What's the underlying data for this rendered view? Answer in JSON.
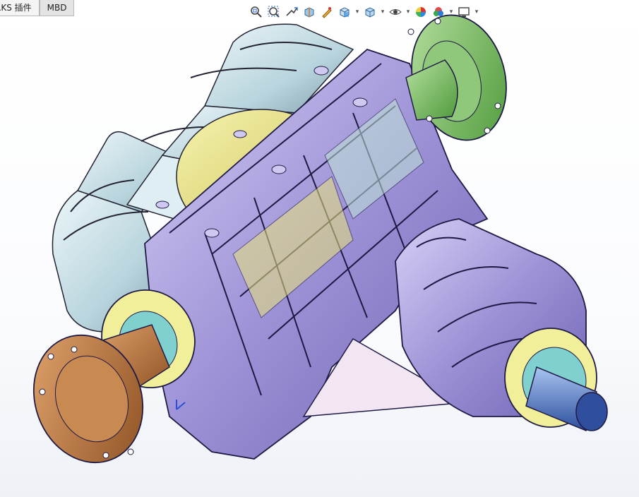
{
  "tabs": [
    {
      "label": "RKS 插件",
      "active": false
    },
    {
      "label": "MBD",
      "active": true
    }
  ],
  "heads_up_toolbar": [
    {
      "icon": "zoom-to-fit-icon"
    },
    {
      "icon": "zoom-to-area-icon"
    },
    {
      "icon": "previous-view-icon"
    },
    {
      "icon": "section-view-icon"
    },
    {
      "icon": "dynamic-annotation-icon"
    },
    {
      "icon": "view-orientation-icon",
      "dropdown": true
    },
    {
      "icon": "display-style-icon",
      "dropdown": true
    },
    {
      "icon": "hide-show-items-icon",
      "dropdown": true
    },
    {
      "icon": "edit-appearance-icon"
    },
    {
      "icon": "apply-scene-icon",
      "dropdown": true
    },
    {
      "icon": "view-settings-icon",
      "dropdown": true
    }
  ],
  "colors": {
    "housing_purple": "#9d92d6",
    "housing_light": "#cfc8f0",
    "cover_blue": "#cfe3ea",
    "gear_yellow": "#e8e27a",
    "flange_green": "#7fbe6a",
    "flange_copper": "#b8743f",
    "shaft_blue": "#6f95d8",
    "ring_yellow": "#f1ef9a"
  }
}
